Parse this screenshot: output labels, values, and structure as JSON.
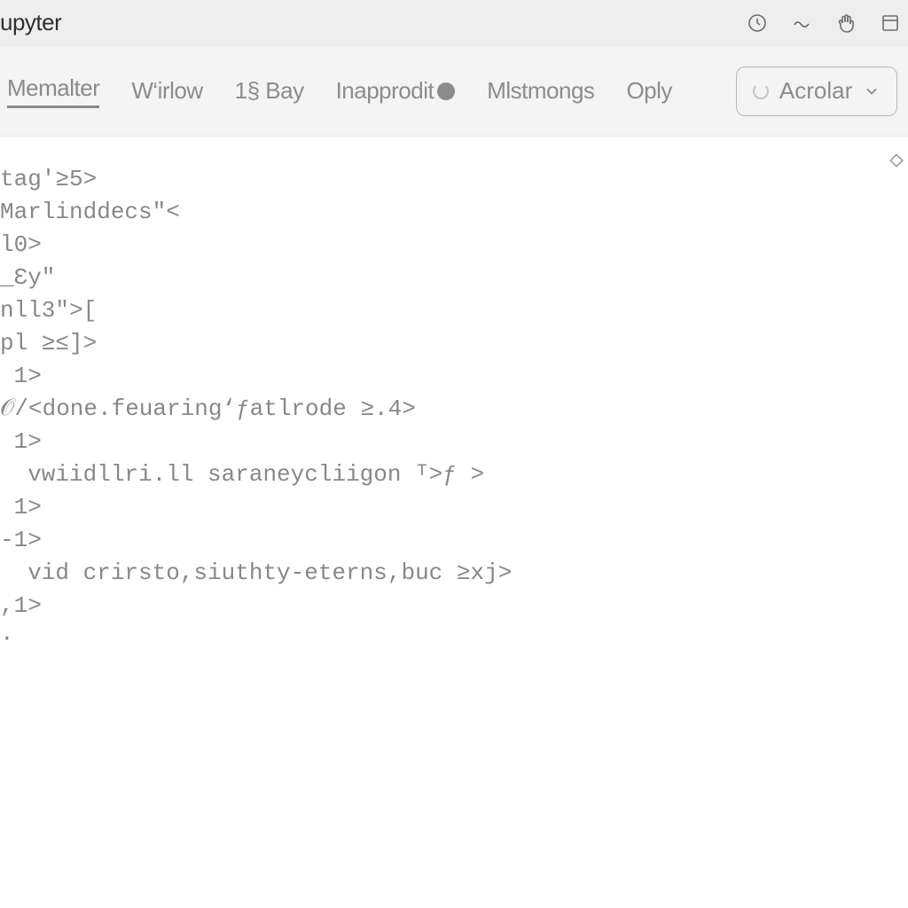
{
  "topbar": {
    "title": "upyter"
  },
  "tabs": {
    "items": [
      {
        "label": "Memalter",
        "active": true
      },
      {
        "label": "W‘irlow"
      },
      {
        "label": "1§ Bay"
      },
      {
        "label": "Inapprodit",
        "has_badge": true
      },
      {
        "label": "Mlstmongs"
      },
      {
        "label": "Oply"
      }
    ],
    "dropdown_label": "Acrolar"
  },
  "code": {
    "lines": [
      "tag'≥5>",
      "Marlinddecs\"<",
      "l0>",
      "_Ɛy\"",
      "nll3\">[",
      "pl ≥≤]>",
      " 1>",
      "𝒪/<done.feuaring‘ƒatlrode ≥.4>",
      " 1>",
      "  vwiidllri.ll saraneycliigon ᵀ>ƒ >",
      " 1>",
      "‑1>",
      "  vid crirsto,siuthty-eterns,buc ≥xϳ>",
      ",1>",
      "·"
    ]
  }
}
